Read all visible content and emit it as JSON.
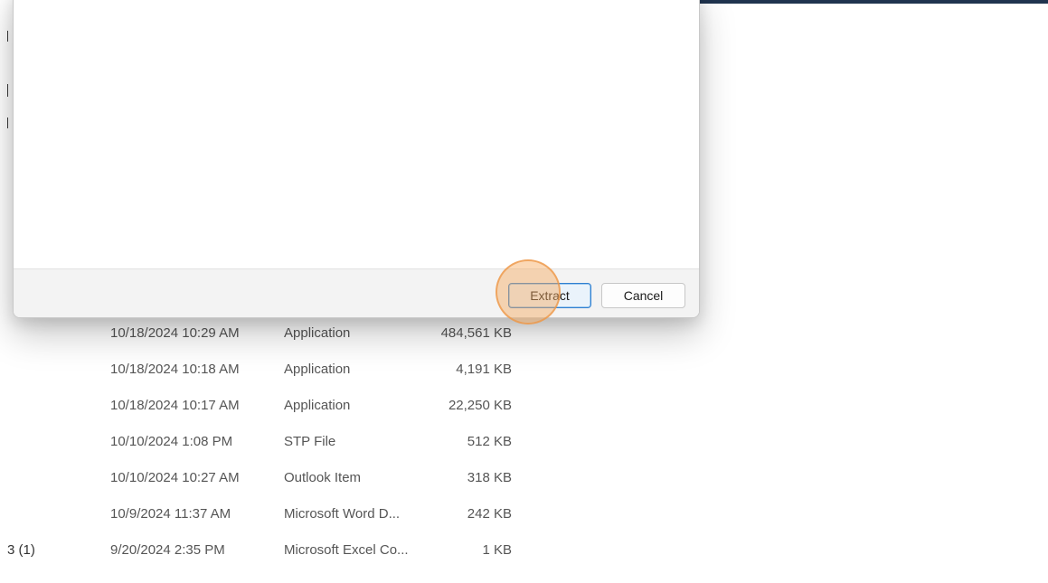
{
  "dialog": {
    "extract_label": "Extract",
    "cancel_label": "Cancel"
  },
  "files": [
    {
      "name": "",
      "date": "10/18/2024 10:29 AM",
      "type": "Application",
      "size": "484,561 KB"
    },
    {
      "name": "",
      "date": "10/18/2024 10:18 AM",
      "type": "Application",
      "size": "4,191 KB"
    },
    {
      "name": "",
      "date": "10/18/2024 10:17 AM",
      "type": "Application",
      "size": "22,250 KB"
    },
    {
      "name": "",
      "date": "10/10/2024 1:08 PM",
      "type": "STP File",
      "size": "512 KB"
    },
    {
      "name": "",
      "date": "10/10/2024 10:27 AM",
      "type": "Outlook Item",
      "size": "318 KB"
    },
    {
      "name": "",
      "date": "10/9/2024 11:37 AM",
      "type": "Microsoft Word D...",
      "size": "242 KB"
    },
    {
      "name": "3 (1)",
      "date": "9/20/2024 2:35 PM",
      "type": "Microsoft Excel Co...",
      "size": "1 KB"
    }
  ],
  "colors": {
    "accent_border": "#2f7fd0",
    "click_highlight": "#f6aa60",
    "header_strip": "#20344f"
  }
}
